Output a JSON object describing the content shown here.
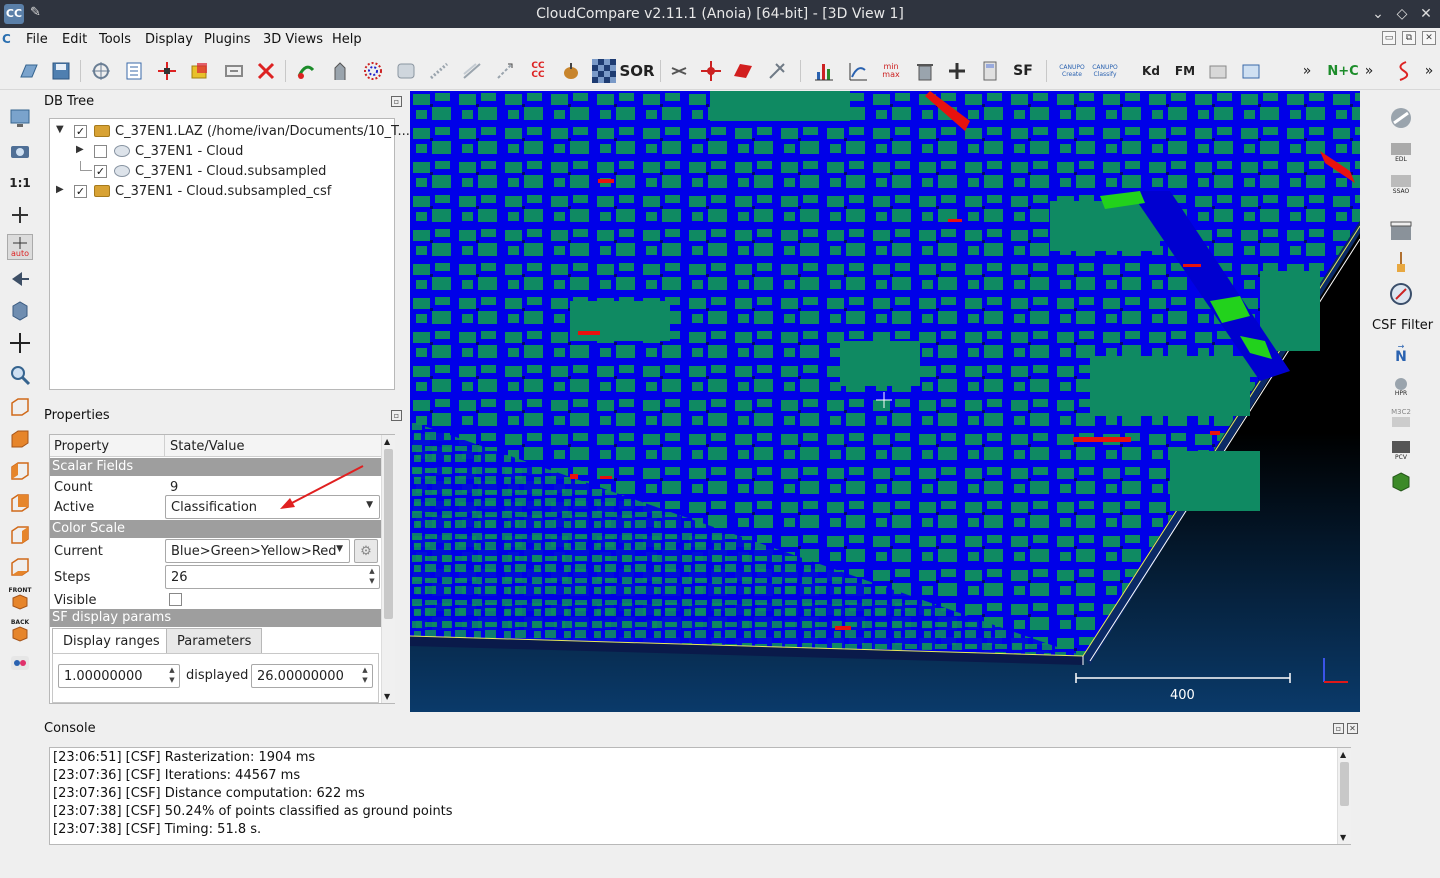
{
  "window": {
    "title": "CloudCompare v2.11.1 (Anoia) [64-bit] - [3D View 1]",
    "app_icon_text": "CC",
    "controls": {
      "minimize": "⌄",
      "maximize": "◇",
      "close": "✕"
    }
  },
  "menu": {
    "logo": "C",
    "items": [
      "File",
      "Edit",
      "Tools",
      "Display",
      "Plugins",
      "3D Views",
      "Help"
    ],
    "mdi_buttons": [
      "▭",
      "⧉",
      "✕"
    ]
  },
  "toolbar": {
    "sor_label": "SOR",
    "sf_label": "SF",
    "canupo_create": "CANUPO Create",
    "canupo_classify": "CANUPO Classify",
    "kd_label": "Kd",
    "fm_label": "FM",
    "nc_label": "N+C",
    "overflow": "»",
    "minmax_label": "min max",
    "cc_label": "CC CC"
  },
  "left_toolbar": {
    "ratio_label": "1:1",
    "auto_label": "auto",
    "front_label": "FRONT",
    "back_label": "BACK"
  },
  "db_tree": {
    "title": "DB Tree",
    "items": [
      {
        "label": "C_37EN1.LAZ (/home/ivan/Documents/10_T...",
        "checked": "✓",
        "expander": "▼"
      },
      {
        "label": "C_37EN1 - Cloud",
        "checked": "",
        "expander": "▶"
      },
      {
        "label": "C_37EN1 - Cloud.subsampled",
        "checked": "✓",
        "expander": ""
      },
      {
        "label": "C_37EN1 - Cloud.subsampled_csf",
        "checked": "✓",
        "expander": "▶"
      }
    ]
  },
  "properties": {
    "title": "Properties",
    "col_property": "Property",
    "col_value": "State/Value",
    "section_scalar": "Scalar Fields",
    "count_label": "Count",
    "count_value": "9",
    "active_label": "Active",
    "active_value": "Classification",
    "section_color": "Color Scale",
    "current_label": "Current",
    "current_value": "Blue>Green>Yellow>Red",
    "steps_label": "Steps",
    "steps_value": "26",
    "visible_label": "Visible",
    "section_sf": "SF display params",
    "tab_ranges": "Display ranges",
    "tab_params": "Parameters",
    "range_min": "1.00000000",
    "displayed_label": "displayed",
    "range_max": "26.00000000"
  },
  "view": {
    "scale_label": "400",
    "colors": {
      "ground": "#0000e8",
      "building": "#0f8a62",
      "vegetation": "#22d21c",
      "highlight": "#e8120e",
      "background_top": "#000000",
      "background_bottom": "#0a3a6a"
    }
  },
  "right_toolbar": {
    "csf_label": "CSF Filter",
    "n_label": "N",
    "hpr_label": "HPR",
    "edl_label": "EDL",
    "ssao_label": "SSAO",
    "pcv_label": "PCV",
    "m3c2_label": "M3C2"
  },
  "console": {
    "title": "Console",
    "lines": [
      "[23:06:51] [CSF] Rasterization: 1904 ms",
      "[23:07:36] [CSF] Iterations: 44567 ms",
      "[23:07:36] [CSF] Distance computation: 622 ms",
      "[23:07:38] [CSF] 50.24% of points classified as ground points",
      "[23:07:38] [CSF] Timing: 51.8 s."
    ]
  }
}
